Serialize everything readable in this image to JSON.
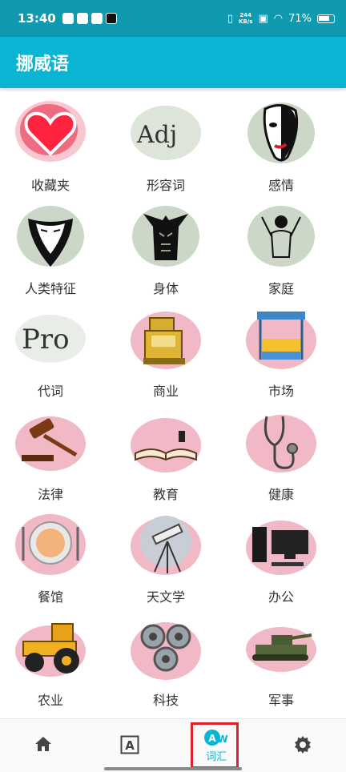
{
  "status": {
    "time": "13:40",
    "netspeed_top": "244",
    "netspeed_bottom": "KB/s",
    "battery": "71%"
  },
  "appbar": {
    "title": "挪威语"
  },
  "categories": [
    {
      "label": "收藏夹",
      "icon": "heart-icon"
    },
    {
      "label": "形容词",
      "icon": "adj-text-icon"
    },
    {
      "label": "感情",
      "icon": "mask-icon"
    },
    {
      "label": "人类特征",
      "icon": "bearded-mask-icon"
    },
    {
      "label": "身体",
      "icon": "body-torso-icon"
    },
    {
      "label": "家庭",
      "icon": "family-figure-icon"
    },
    {
      "label": "代词",
      "icon": "pro-text-icon"
    },
    {
      "label": "商业",
      "icon": "cash-register-icon"
    },
    {
      "label": "市场",
      "icon": "market-stall-icon"
    },
    {
      "label": "法律",
      "icon": "gavel-icon"
    },
    {
      "label": "教育",
      "icon": "open-book-icon"
    },
    {
      "label": "健康",
      "icon": "stethoscope-icon"
    },
    {
      "label": "餐馆",
      "icon": "plate-icon"
    },
    {
      "label": "天文学",
      "icon": "telescope-icon"
    },
    {
      "label": "办公",
      "icon": "computer-icon"
    },
    {
      "label": "农业",
      "icon": "tractor-icon"
    },
    {
      "label": "科技",
      "icon": "gears-icon"
    },
    {
      "label": "军事",
      "icon": "tank-icon"
    }
  ],
  "nav": {
    "items": [
      {
        "icon": "home-icon"
      },
      {
        "icon": "letter-a-icon"
      },
      {
        "icon": "vocabulary-icon",
        "label": "词汇",
        "active": true
      },
      {
        "icon": "settings-icon"
      }
    ]
  },
  "colors": {
    "statusbar": "#0f9ab0",
    "appbar": "#0ab4d3",
    "accent": "#0ab4d3",
    "splash_red": "#d8355a",
    "splash_green": "#8fa685",
    "highlight": "#e0202a"
  }
}
